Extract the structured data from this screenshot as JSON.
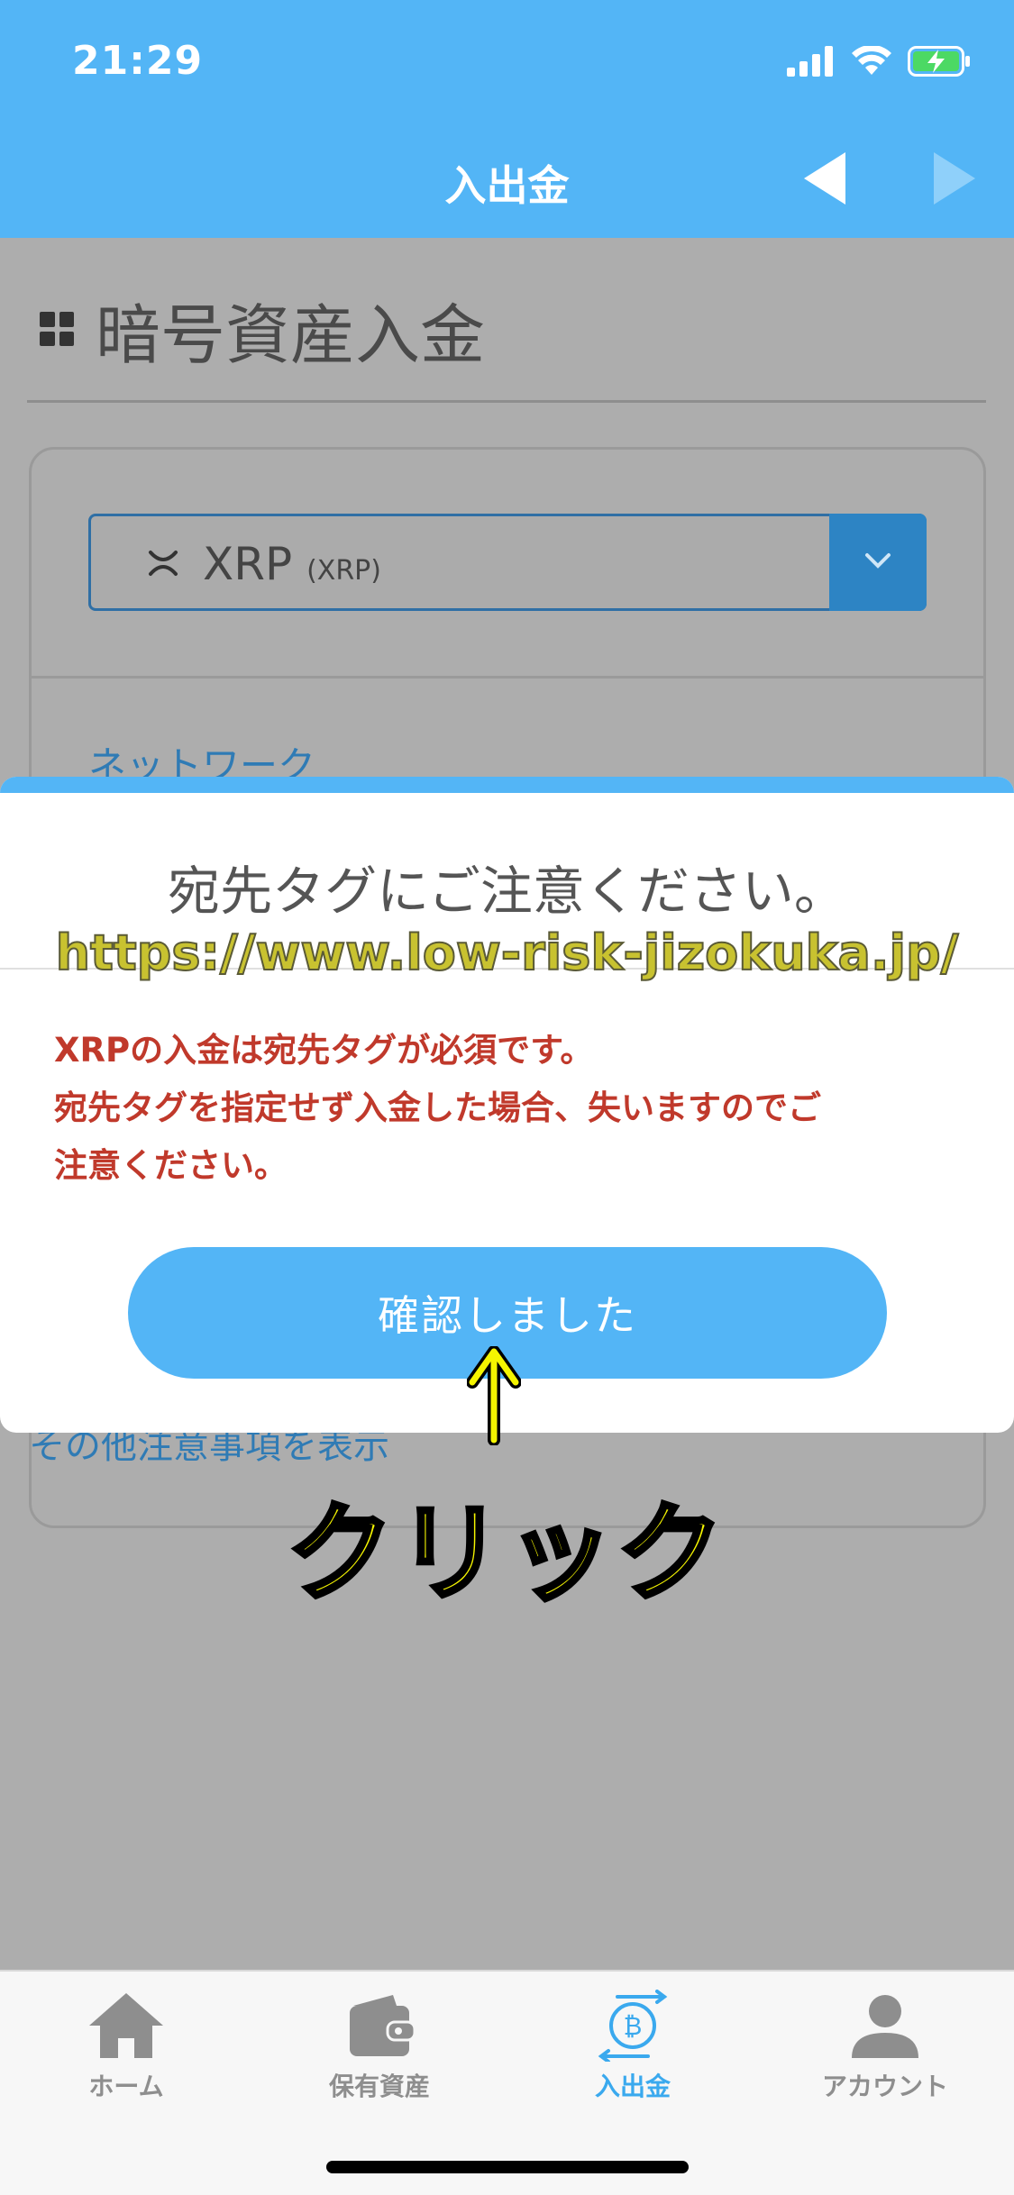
{
  "status_bar": {
    "time": "21:29"
  },
  "nav": {
    "title": "入出金"
  },
  "page": {
    "title": "暗号資産入金",
    "currency_select": {
      "name": "XRP",
      "ticker": "(XRP)"
    },
    "network_label": "ネットワーク",
    "other_notes_link": "その他注意事項を表示"
  },
  "modal": {
    "title": "宛先タグにご注意ください。",
    "warning_lines": [
      "XRPの入金は宛先タグが必須です。",
      "宛先タグを指定せず入金した場合、失いますのでご",
      "注意ください。"
    ],
    "confirm_label": "確認しました"
  },
  "watermark": "https://www.low-risk-jizokuka.jp/",
  "annotation": {
    "label": "クリック"
  },
  "tabbar": {
    "items": [
      {
        "label": "ホーム",
        "icon": "home-icon"
      },
      {
        "label": "保有資産",
        "icon": "wallet-icon"
      },
      {
        "label": "入出金",
        "icon": "bitcoin-transfer-icon"
      },
      {
        "label": "アカウント",
        "icon": "person-icon"
      }
    ],
    "active_index": 2
  },
  "colors": {
    "accent": "#53b5f6",
    "warning_text": "#c0392b",
    "overlay_background": "#adadad",
    "annotation_yellow": "#f5f500"
  }
}
